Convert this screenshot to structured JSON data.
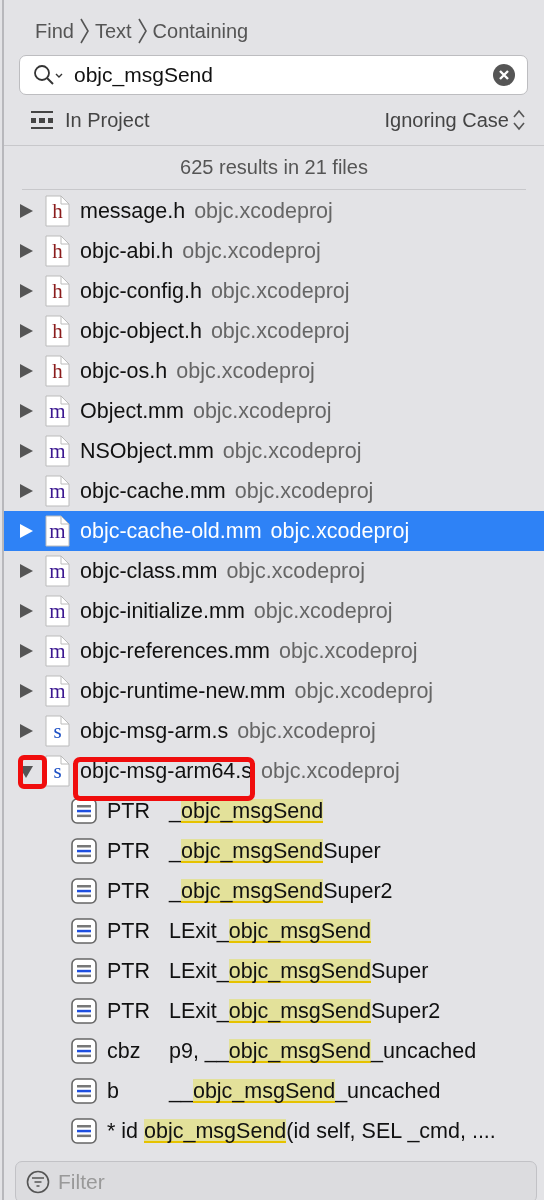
{
  "breadcrumb": [
    "Find",
    "Text",
    "Containing"
  ],
  "search": {
    "value": "objc_msgSend"
  },
  "scope": {
    "label": "In Project"
  },
  "case_option": {
    "label": "Ignoring Case"
  },
  "summary": "625 results in 21 files",
  "results": [
    {
      "kind": "h",
      "letter": "h",
      "name": "message.h",
      "project": "objc.xcodeproj",
      "expanded": false,
      "selected": false,
      "outlined": false
    },
    {
      "kind": "h",
      "letter": "h",
      "name": "objc-abi.h",
      "project": "objc.xcodeproj",
      "expanded": false,
      "selected": false,
      "outlined": false
    },
    {
      "kind": "h",
      "letter": "h",
      "name": "objc-config.h",
      "project": "objc.xcodeproj",
      "expanded": false,
      "selected": false,
      "outlined": false
    },
    {
      "kind": "h",
      "letter": "h",
      "name": "objc-object.h",
      "project": "objc.xcodeproj",
      "expanded": false,
      "selected": false,
      "outlined": false
    },
    {
      "kind": "h",
      "letter": "h",
      "name": "objc-os.h",
      "project": "objc.xcodeproj",
      "expanded": false,
      "selected": false,
      "outlined": false
    },
    {
      "kind": "m",
      "letter": "m",
      "name": "Object.mm",
      "project": "objc.xcodeproj",
      "expanded": false,
      "selected": false,
      "outlined": false
    },
    {
      "kind": "m",
      "letter": "m",
      "name": "NSObject.mm",
      "project": "objc.xcodeproj",
      "expanded": false,
      "selected": false,
      "outlined": false
    },
    {
      "kind": "m",
      "letter": "m",
      "name": "objc-cache.mm",
      "project": "objc.xcodeproj",
      "expanded": false,
      "selected": false,
      "outlined": false
    },
    {
      "kind": "m",
      "letter": "m",
      "name": "objc-cache-old.mm",
      "project": "objc.xcodeproj",
      "expanded": false,
      "selected": true,
      "outlined": false
    },
    {
      "kind": "m",
      "letter": "m",
      "name": "objc-class.mm",
      "project": "objc.xcodeproj",
      "expanded": false,
      "selected": false,
      "outlined": false
    },
    {
      "kind": "m",
      "letter": "m",
      "name": "objc-initialize.mm",
      "project": "objc.xcodeproj",
      "expanded": false,
      "selected": false,
      "outlined": false
    },
    {
      "kind": "m",
      "letter": "m",
      "name": "objc-references.mm",
      "project": "objc.xcodeproj",
      "expanded": false,
      "selected": false,
      "outlined": false
    },
    {
      "kind": "m",
      "letter": "m",
      "name": "objc-runtime-new.mm",
      "project": "objc.xcodeproj",
      "expanded": false,
      "selected": false,
      "outlined": false
    },
    {
      "kind": "s",
      "letter": "s",
      "name": "objc-msg-arm.s",
      "project": "objc.xcodeproj",
      "expanded": false,
      "selected": false,
      "outlined": false
    },
    {
      "kind": "s",
      "letter": "s",
      "name": "objc-msg-arm64.s",
      "project": "objc.xcodeproj",
      "expanded": true,
      "selected": false,
      "outlined": true,
      "children": [
        {
          "op": "PTR",
          "prefix": "_",
          "match": "objc_msgSend"
        },
        {
          "op": "PTR",
          "prefix": "_",
          "match": "objc_msgSend",
          "suffix": "Super"
        },
        {
          "op": "PTR",
          "prefix": "_",
          "match": "objc_msgSend",
          "suffix": "Super2"
        },
        {
          "op": "PTR",
          "prefix": "LExit_",
          "match": "objc_msgSend"
        },
        {
          "op": "PTR",
          "prefix": "LExit_",
          "match": "objc_msgSend",
          "suffix": "Super"
        },
        {
          "op": "PTR",
          "prefix": "LExit_",
          "match": "objc_msgSend",
          "suffix": "Super2"
        },
        {
          "op": "cbz",
          "prefix": "p9, __",
          "match": "objc_msgSend",
          "suffix": "_uncached"
        },
        {
          "op": "b",
          "prefix": "__",
          "match": "objc_msgSend",
          "suffix": "_uncached"
        },
        {
          "prefix": "* id ",
          "match": "objc_msgSend",
          "suffix": "(id self, SEL _cmd, ...."
        }
      ]
    }
  ],
  "filter": {
    "placeholder": "Filter"
  }
}
